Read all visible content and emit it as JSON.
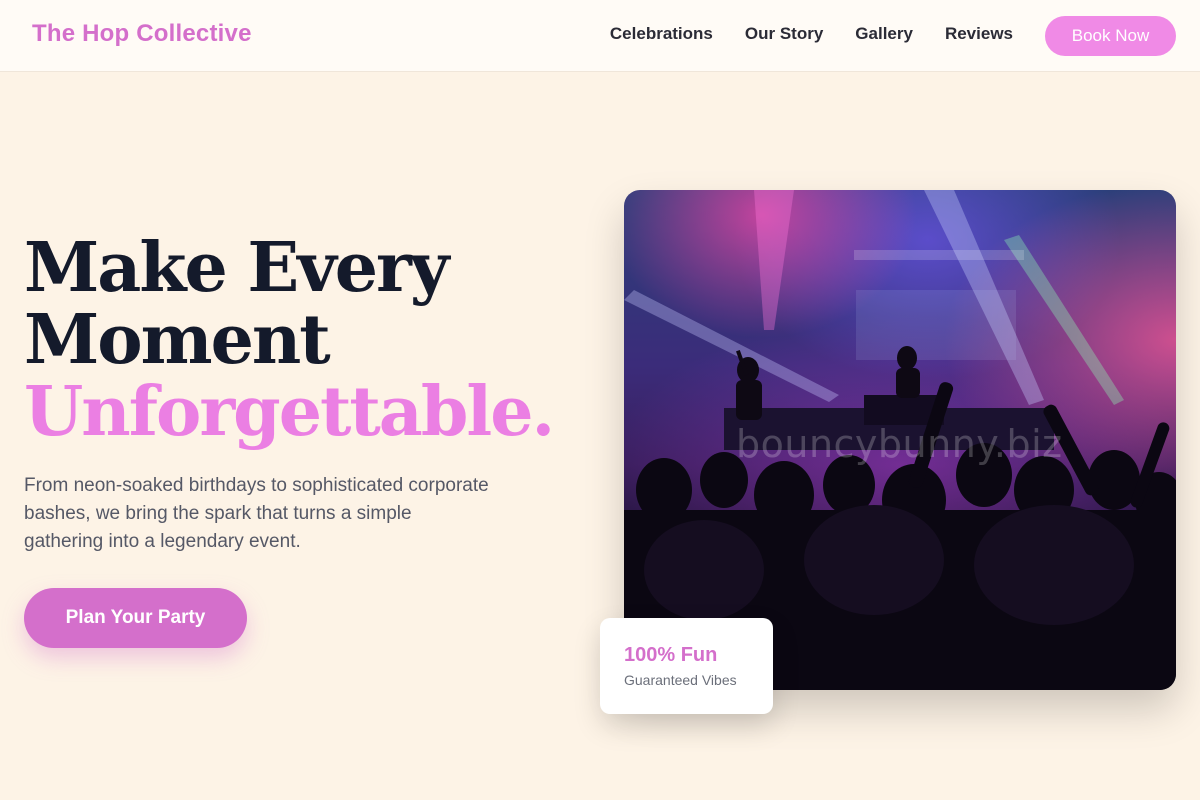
{
  "header": {
    "logo": "The Hop Collective",
    "nav": [
      {
        "label": "Celebrations"
      },
      {
        "label": "Our Story"
      },
      {
        "label": "Gallery"
      },
      {
        "label": "Reviews"
      }
    ],
    "book_label": "Book Now"
  },
  "hero": {
    "headline_line1": "Make Every",
    "headline_line2": "Moment",
    "headline_accent": "Unforgettable.",
    "subtext": "From neon-soaked birthdays to sophisticated corporate bashes, we bring the spark that turns a simple gathering into a legendary event.",
    "cta_label": "Plan Your Party",
    "image_watermark": "bouncybunny.biz",
    "badge_title": "100% Fun",
    "badge_sub": "Guaranteed Vibes"
  },
  "colors": {
    "brand": "#d46fcb",
    "accent": "#eb7fe3",
    "button": "#f08ae6",
    "background": "#fdf3e6",
    "heading": "#141a2b"
  }
}
